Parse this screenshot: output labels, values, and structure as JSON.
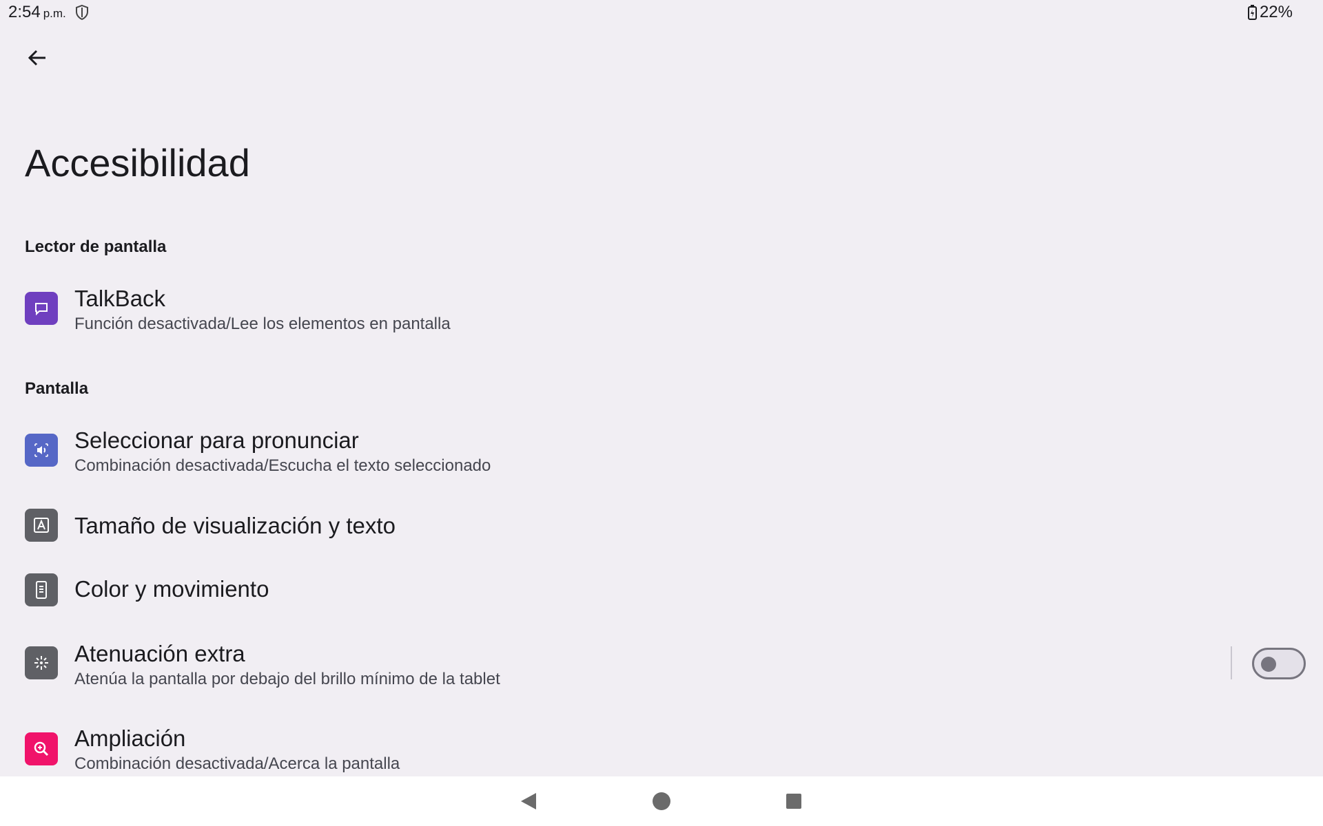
{
  "status_bar": {
    "time": "2:54",
    "ampm": "p.m.",
    "battery": "22%"
  },
  "page": {
    "title": "Accesibilidad"
  },
  "sections": {
    "screen_reader": "Lector de pantalla",
    "display": "Pantalla"
  },
  "items": {
    "talkback": {
      "title": "TalkBack",
      "summary": "Función desactivada/Lee los elementos en pantalla",
      "icon": "talkback-icon",
      "color": "#6f3fbf"
    },
    "select_to_speak": {
      "title": "Seleccionar para pronunciar",
      "summary": "Combinación desactivada/Escucha el texto seleccionado",
      "icon": "speaker-icon",
      "color": "#5667c6"
    },
    "display_size": {
      "title": "Tamaño de visualización y texto",
      "icon": "text-size-icon",
      "color": "#5f6065"
    },
    "color_motion": {
      "title": "Color y movimiento",
      "icon": "phone-color-icon",
      "color": "#5f6065"
    },
    "extra_dim": {
      "title": "Atenuación extra",
      "summary": "Atenúa la pantalla por debajo del brillo mínimo de la tablet",
      "icon": "dim-icon",
      "color": "#5f6065",
      "toggle_on": false
    },
    "magnification": {
      "title": "Ampliación",
      "summary": "Combinación desactivada/Acerca la pantalla",
      "icon": "magnify-icon",
      "color": "#f0136a"
    }
  }
}
